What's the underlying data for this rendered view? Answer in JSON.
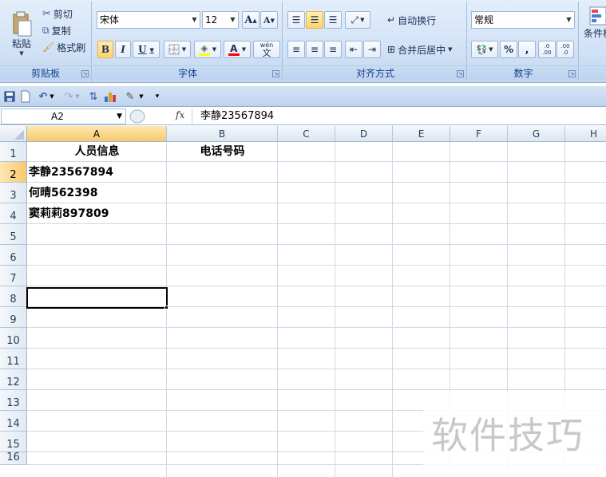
{
  "ribbon": {
    "clipboard": {
      "paste": "粘贴",
      "cut": "剪切",
      "copy": "复制",
      "format_painter": "格式刷",
      "group_label": "剪贴板"
    },
    "font": {
      "font_name": "宋体",
      "font_size": "12",
      "group_label": "字体",
      "bold": "B",
      "italic": "I",
      "underline": "U",
      "grow": "A",
      "shrink": "A",
      "font_color": "A",
      "phonetic": "wén"
    },
    "alignment": {
      "wrap_text": "自动换行",
      "merge_center": "合并后居中",
      "group_label": "对齐方式"
    },
    "number": {
      "format": "常规",
      "percent": "%",
      "comma": ",",
      "increase_decimal": ".0 .00",
      "decrease_decimal": ".00 .0",
      "group_label": "数字"
    },
    "styles": {
      "conditional": "条件格"
    }
  },
  "formula_bar": {
    "name_box": "A2",
    "fx": "fx",
    "content": "李静23567894"
  },
  "grid": {
    "columns": [
      "A",
      "B",
      "C",
      "D",
      "E",
      "F",
      "G",
      "H"
    ],
    "rows": [
      "1",
      "2",
      "3",
      "4",
      "5",
      "6",
      "7",
      "8",
      "9",
      "10",
      "11",
      "12",
      "13",
      "14",
      "15",
      "16"
    ],
    "cells": {
      "A1": "人员信息",
      "B1": "电话号码",
      "A2": "李静23567894",
      "A3": "何晴562398",
      "A4": "窦莉莉897809"
    },
    "selected_cell": "A2"
  },
  "watermark": "软件技巧",
  "colors": {
    "accent": "#15428b",
    "selection": "#f8c96c",
    "ribbon": "#d2e2f6"
  }
}
